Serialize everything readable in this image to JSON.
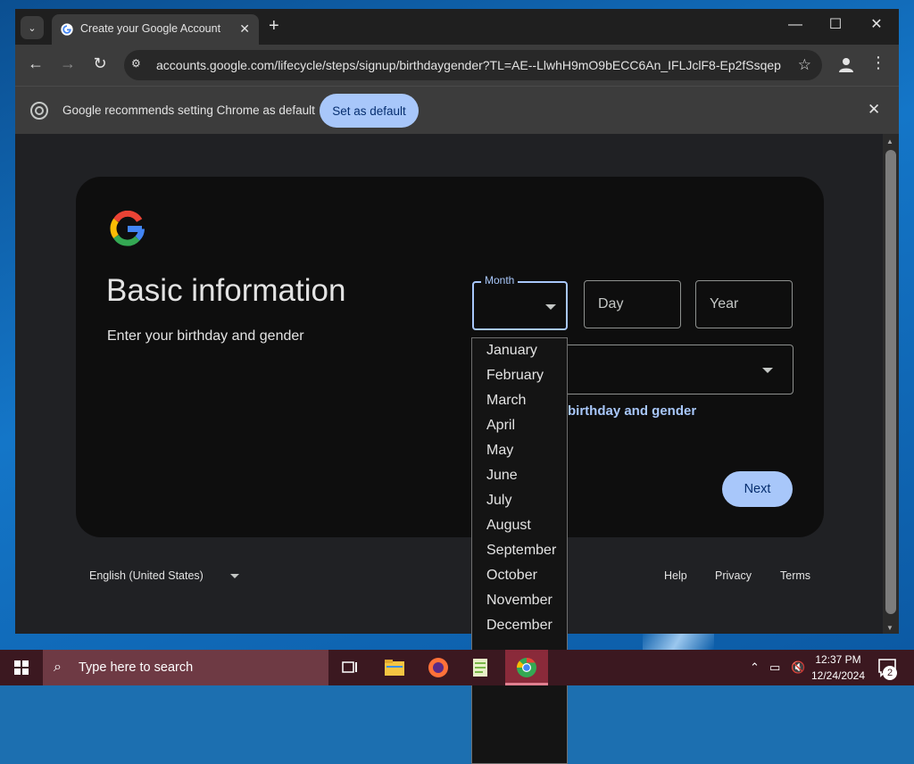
{
  "browser": {
    "tab_title": "Create your Google Account",
    "url": "accounts.google.com/lifecycle/steps/signup/birthdaygender?TL=AE--LlwhH9mO9bECC6An_IFLJclF8-Ep2fSsqep...",
    "infobar_text": "Google recommends setting Chrome as default",
    "set_default_label": "Set as default"
  },
  "page": {
    "title": "Basic information",
    "subtitle": "Enter your birthday and gender",
    "month_label": "Month",
    "day_placeholder": "Day",
    "year_placeholder": "Year",
    "why_link": "birthday and gender",
    "next_label": "Next",
    "language": "English (United States)",
    "footer_links": [
      "Help",
      "Privacy",
      "Terms"
    ],
    "months": [
      "January",
      "February",
      "March",
      "April",
      "May",
      "June",
      "July",
      "August",
      "September",
      "October",
      "November",
      "December"
    ]
  },
  "taskbar": {
    "search_placeholder": "Type here to search",
    "time": "12:37 PM",
    "date": "12/24/2024",
    "notification_count": "2"
  },
  "colors": {
    "accent": "#a8c7fa",
    "card_bg": "#0e0e0e",
    "page_bg": "#202124",
    "taskbar_bg": "#3b1820"
  }
}
